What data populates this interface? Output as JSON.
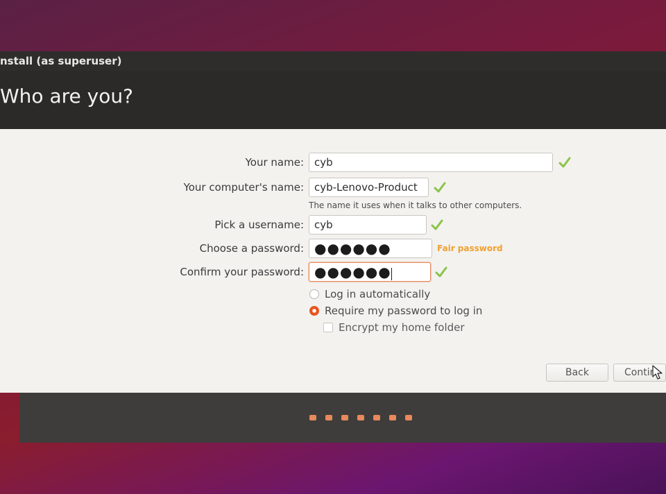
{
  "window": {
    "title": "nstall (as superuser)",
    "heading": "Who are you?"
  },
  "form": {
    "name": {
      "label": "Your name:",
      "value": "cyb"
    },
    "computer": {
      "label": "Your computer's name:",
      "value": "cyb-Lenovo-Product",
      "hint": "The name it uses when it talks to other computers."
    },
    "username": {
      "label": "Pick a username:",
      "value": "cyb"
    },
    "password": {
      "label": "Choose a password:",
      "value": "●●●●●●",
      "strength": "Fair password"
    },
    "confirm": {
      "label": "Confirm your password:",
      "value": "●●●●●●"
    }
  },
  "options": {
    "auto_login": {
      "label": "Log in automatically",
      "selected": false
    },
    "require_password": {
      "label": "Require my password to log in",
      "selected": true
    },
    "encrypt_home": {
      "label": "Encrypt my home folder",
      "checked": false
    }
  },
  "buttons": {
    "back": "Back",
    "continue": "Contin"
  },
  "progress": {
    "total_steps": 7
  },
  "colors": {
    "accent": "#e95420",
    "check": "#8bc34a",
    "strength": "#f0a030",
    "header_bg": "#2b2a29",
    "content_bg": "#f3f2ef"
  }
}
